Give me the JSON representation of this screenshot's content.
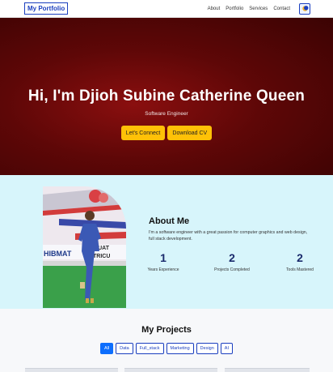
{
  "nav": {
    "brand": "My Portfolio",
    "links": [
      "About",
      "Portfolio",
      "Services",
      "Contact"
    ]
  },
  "hero": {
    "title": "Hi, I'm Djioh Subine Catherine Queen",
    "subtitle": "Software Engineer",
    "primary_btn": "Let's Connect",
    "secondary_btn": "Download CV"
  },
  "about": {
    "title": "About Me",
    "text": "I'm a software engineer with a great passion for computer graphics and web design, full stack development.",
    "stats": [
      {
        "value": "1",
        "label": "Years Experience"
      },
      {
        "value": "2",
        "label": "Projects Completed"
      },
      {
        "value": "2",
        "label": "Tools Mastered"
      }
    ],
    "photo_texts": [
      "HIBMAT",
      "ADUAT",
      "TRICU"
    ]
  },
  "projects": {
    "title": "My Projects",
    "filters": [
      "All",
      "Data",
      "Full_stack",
      "Marketing",
      "Design",
      "AI"
    ],
    "active_filter": "All"
  },
  "colors": {
    "hero_bg": "#5e0707",
    "accent_yellow": "#ffc107",
    "brand_blue": "#1b3fbf",
    "about_bg": "#d7f5fb",
    "stat_navy": "#1a2a6c"
  }
}
